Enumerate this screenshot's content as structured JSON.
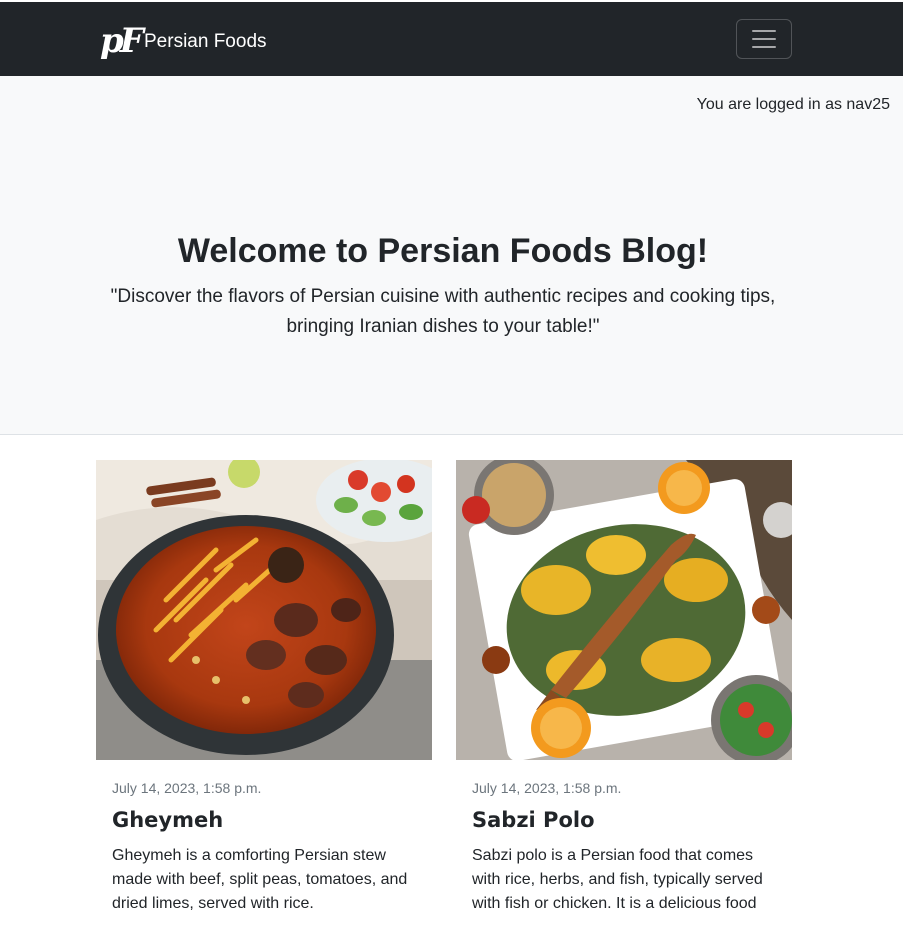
{
  "navbar": {
    "brand_logo": "pF",
    "brand_name": "Persian Foods",
    "toggler_icon": "hamburger-menu-icon"
  },
  "login_status": "You are logged in as nav25",
  "hero": {
    "title": "Welcome to Persian Foods Blog!",
    "tagline": "\"Discover the flavors of Persian cuisine with authentic recipes and cooking tips, bringing Iranian dishes to your table!\""
  },
  "posts": [
    {
      "date": "July 14, 2023, 1:58 p.m.",
      "title": "Gheymeh",
      "excerpt": "Gheymeh is a comforting Persian stew made with beef, split peas, tomatoes, and dried limes, served with rice."
    },
    {
      "date": "July 14, 2023, 1:58 p.m.",
      "title": "Sabzi Polo",
      "excerpt": "Sabzi polo is a Persian food that comes with rice, herbs, and fish, typically served with fish or chicken. It is a delicious food"
    }
  ],
  "colors": {
    "navbar_bg": "#212529",
    "light_bg": "#f8f9fa",
    "muted_text": "#6c757d"
  }
}
